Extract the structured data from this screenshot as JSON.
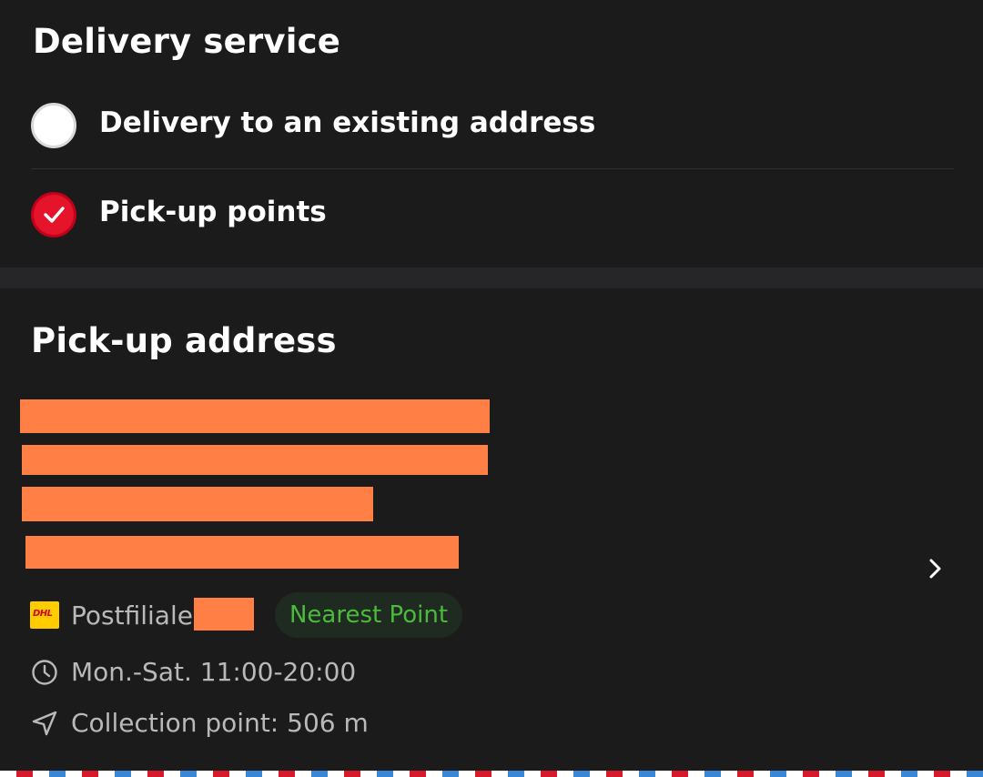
{
  "delivery_service": {
    "title": "Delivery service",
    "options": [
      {
        "label": "Delivery to an existing address",
        "selected": false
      },
      {
        "label": "Pick-up points",
        "selected": true
      }
    ],
    "accent_color": "#e5142b"
  },
  "pickup_address": {
    "title": "Pick-up address",
    "provider_logo_text": "DHL",
    "provider_name": "Postfiliale",
    "badge": "Nearest Point",
    "badge_color": "#4cba3c",
    "hours": "Mon.-Sat. 11:00-20:00",
    "distance": "Collection point: 506 m",
    "redaction_color": "#ff7f45"
  },
  "icons": {
    "selected_check": "check-icon",
    "chevron": "chevron-right-icon",
    "clock": "clock-icon",
    "location": "navigation-arrow-icon",
    "provider": "dhl-logo-icon"
  }
}
